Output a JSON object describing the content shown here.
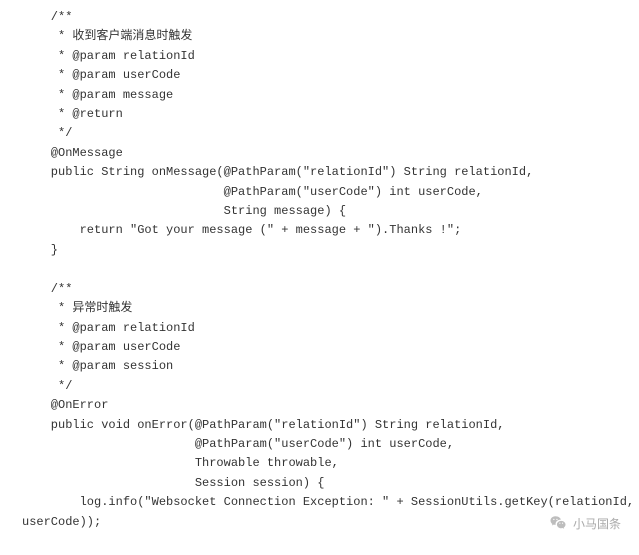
{
  "code": {
    "lines": [
      "    /**",
      "     * 收到客户端消息时触发",
      "     * @param relationId",
      "     * @param userCode",
      "     * @param message",
      "     * @return",
      "     */",
      "    @OnMessage",
      "    public String onMessage(@PathParam(\"relationId\") String relationId,",
      "                            @PathParam(\"userCode\") int userCode,",
      "                            String message) {",
      "        return \"Got your message (\" + message + \").Thanks !\";",
      "    }",
      "",
      "    /**",
      "     * 异常时触发",
      "     * @param relationId",
      "     * @param userCode",
      "     * @param session",
      "     */",
      "    @OnError",
      "    public void onError(@PathParam(\"relationId\") String relationId,",
      "                        @PathParam(\"userCode\") int userCode,",
      "                        Throwable throwable,",
      "                        Session session) {",
      "        log.info(\"Websocket Connection Exception: \" + SessionUtils.getKey(relationId, ",
      "userCode));"
    ]
  },
  "watermark": {
    "text": "小马国条"
  }
}
